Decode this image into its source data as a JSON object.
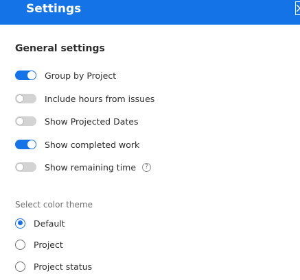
{
  "header": {
    "title": "Settings",
    "close_icon": "close-icon",
    "background": "#1473e6"
  },
  "general": {
    "title": "General settings",
    "toggles": [
      {
        "label": "Group by Project",
        "on": true
      },
      {
        "label": "Include hours from issues",
        "on": false
      },
      {
        "label": "Show Projected Dates",
        "on": false
      },
      {
        "label": "Show completed work",
        "on": true
      },
      {
        "label": "Show remaining time",
        "on": false,
        "help_icon": "question-mark-circle-icon"
      }
    ],
    "help_glyph": "?"
  },
  "color_theme": {
    "label": "Select color theme",
    "options": [
      {
        "label": "Default",
        "selected": true
      },
      {
        "label": "Project",
        "selected": false
      },
      {
        "label": "Project status",
        "selected": false
      }
    ]
  },
  "colors": {
    "accent": "#1473e6",
    "toggle_off": "#d3d3d3",
    "text": "#2c2c2c",
    "muted_text": "#6e6e6e"
  }
}
